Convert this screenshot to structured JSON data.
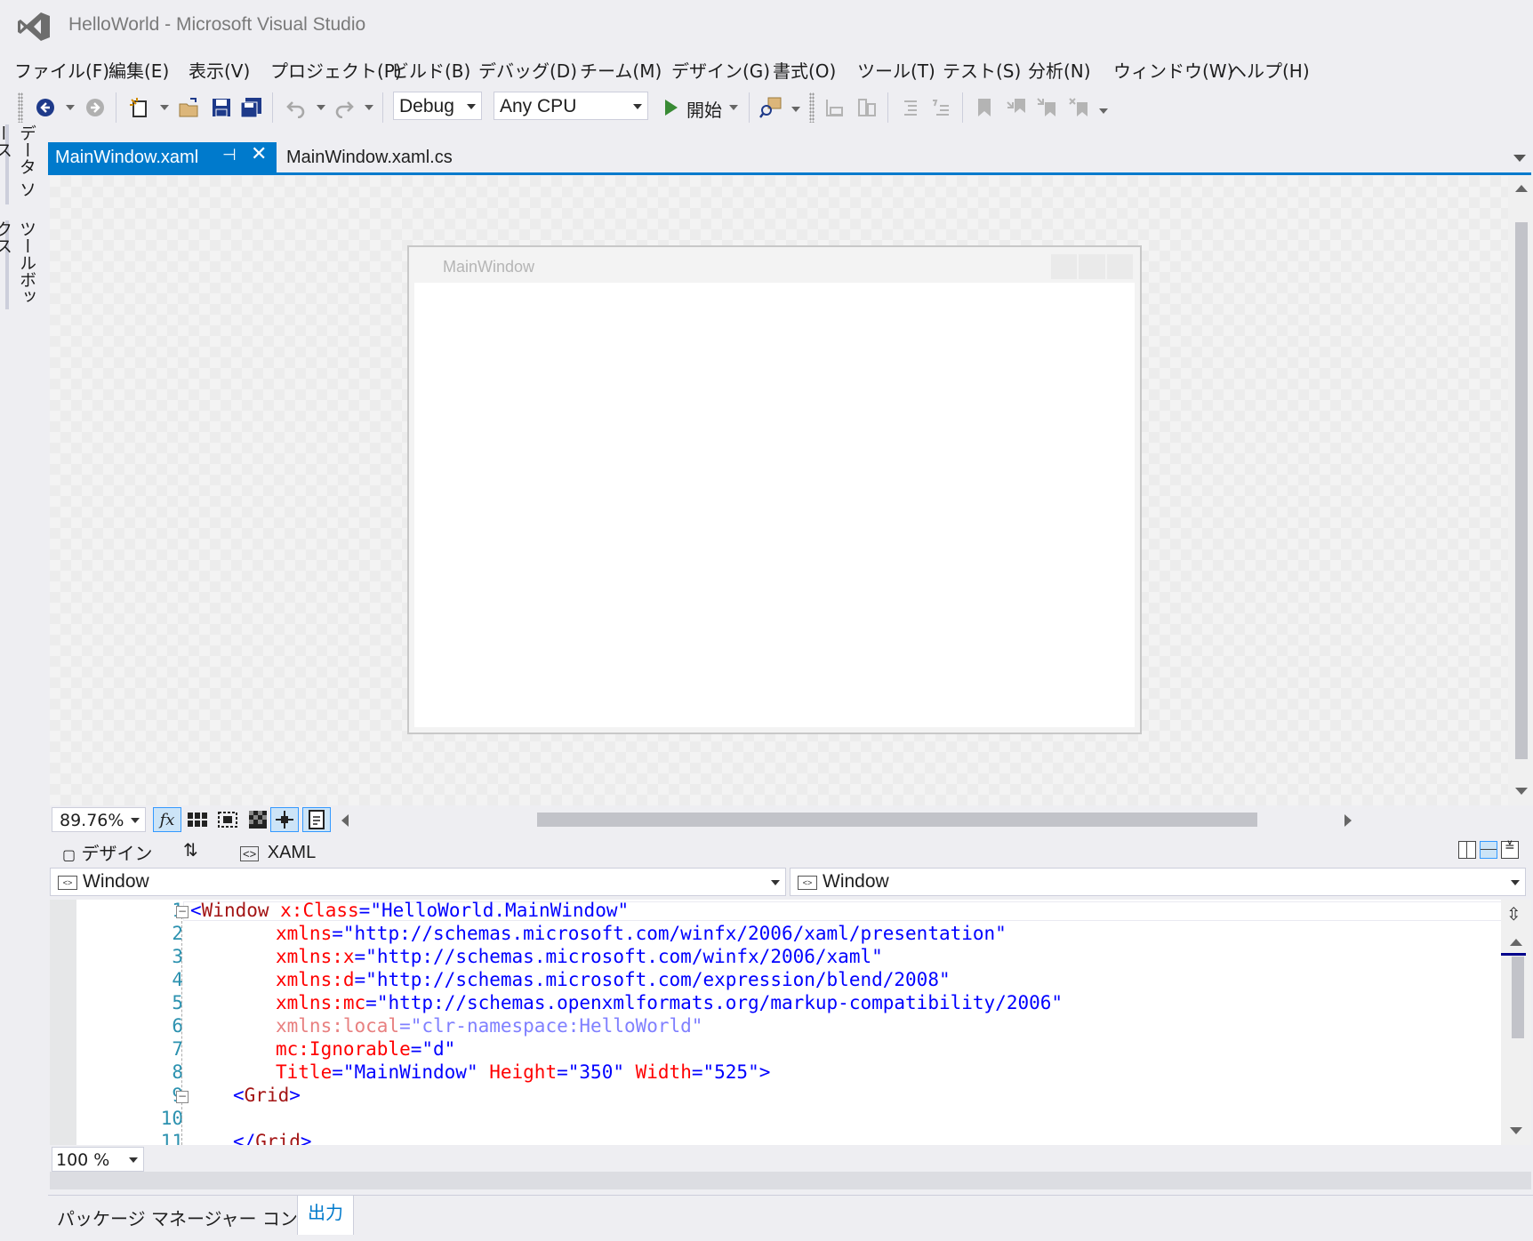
{
  "window": {
    "title": "HelloWorld - Microsoft Visual Studio"
  },
  "menu": [
    "ファイル(F)",
    "編集(E)",
    "表示(V)",
    "プロジェクト(P)",
    "ビルド(B)",
    "デバッグ(D)",
    "チーム(M)",
    "デザイン(G)",
    "書式(O)",
    "ツール(T)",
    "テスト(S)",
    "分析(N)",
    "ウィンドウ(W)",
    "ヘルプ(H)"
  ],
  "toolbar": {
    "config": "Debug",
    "platform": "Any CPU",
    "start_label": "開始"
  },
  "side_tabs": [
    "データ ソース",
    "ツールボックス"
  ],
  "doc_tabs": {
    "active": "MainWindow.xaml",
    "other": "MainWindow.xaml.cs"
  },
  "designer": {
    "window_title": "MainWindow",
    "zoom": "89.76%",
    "fx": "fx"
  },
  "split": {
    "design_tab": "デザイン",
    "xaml_tab": "XAML"
  },
  "nav": {
    "left": "Window",
    "right": "Window"
  },
  "editor": {
    "line_numbers": [
      "1",
      "2",
      "3",
      "4",
      "5",
      "6",
      "7",
      "8",
      "9",
      "10",
      "11"
    ],
    "zoom": "100 %",
    "lines": {
      "l1": {
        "open": "<",
        "tag": "Window",
        "attr": " x:Class",
        "eq": "=",
        "val": "\"HelloWorld.MainWindow\""
      },
      "l2": {
        "attr": "xmlns",
        "eq": "=",
        "val": "\"http://schemas.microsoft.com/winfx/2006/xaml/presentation\""
      },
      "l3": {
        "attr": "xmlns:x",
        "eq": "=",
        "val": "\"http://schemas.microsoft.com/winfx/2006/xaml\""
      },
      "l4": {
        "attr": "xmlns:d",
        "eq": "=",
        "val": "\"http://schemas.microsoft.com/expression/blend/2008\""
      },
      "l5": {
        "attr": "xmlns:mc",
        "eq": "=",
        "val": "\"http://schemas.openxmlformats.org/markup-compatibility/2006\""
      },
      "l6": {
        "attr": "xmlns:local",
        "eq": "=",
        "val": "\"clr-namespace:HelloWorld\""
      },
      "l7": {
        "attr": "mc:Ignorable",
        "eq": "=",
        "val": "\"d\""
      },
      "l8": {
        "attr1": "Title",
        "val1": "\"MainWindow\"",
        "attr2": " Height",
        "val2": "\"350\"",
        "attr3": " Width",
        "val3": "\"525\"",
        "close": ">"
      },
      "l9": {
        "open": "<",
        "tag": "Grid",
        "close": ">"
      },
      "l11": {
        "open": "</",
        "tag": "Grid",
        "close": ">"
      }
    }
  },
  "tool_tabs": [
    "パッケージ マネージャー コンソール",
    "出力"
  ],
  "colors": {
    "accent": "#007acc",
    "tag": "#a31515",
    "attr": "#ff0000",
    "value": "#0000ff",
    "line_number": "#2b91af"
  }
}
